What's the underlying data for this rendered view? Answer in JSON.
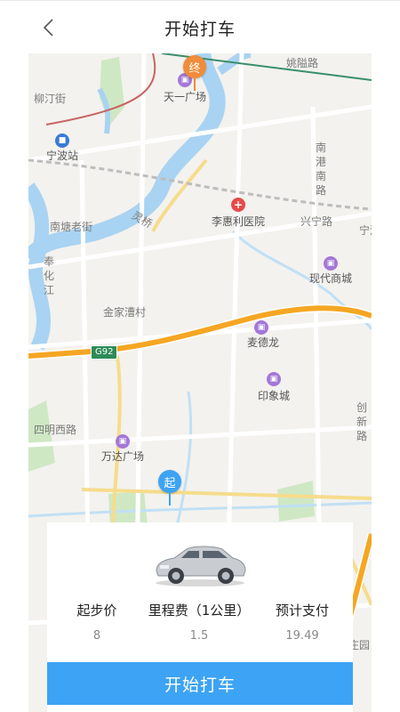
{
  "header": {
    "title": "开始打车"
  },
  "icons": {
    "back": "chevron-left-icon",
    "car": "car-icon"
  },
  "colors": {
    "accent": "#3da3f4",
    "highway": "#f5a623",
    "start_marker": "#3da3f4",
    "end_marker": "#f08c3a",
    "water": "#a9d3f2",
    "map_bg": "#f3f2ee"
  },
  "map": {
    "labels": [
      "姚隘路",
      "柳汀街",
      "天一广场",
      "宁波站",
      "南港南路",
      "灵桥",
      "李惠利医院",
      "兴宁路",
      "宁波",
      "南塘老街",
      "现代商城",
      "奉化江",
      "金家漕村",
      "G92",
      "麦德龙",
      "印象城",
      "四明西路",
      "创新路",
      "万达广场",
      "庄园"
    ],
    "start_marker": "起",
    "end_marker": "终"
  },
  "fare": {
    "start_price_label": "起步价",
    "start_price_value": "8",
    "mileage_label": "里程费（1公里）",
    "mileage_value": "1.5",
    "estimate_label": "预计支付",
    "estimate_value": "19.49"
  },
  "action": {
    "start_button": "开始打车"
  }
}
